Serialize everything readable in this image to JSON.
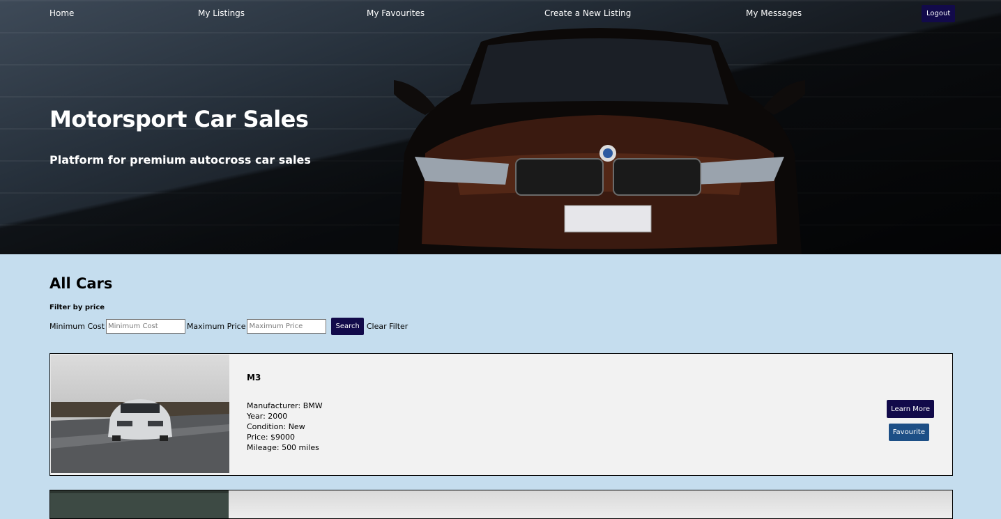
{
  "nav": {
    "home": "Home",
    "my_listings": "My Listings",
    "my_favourites": "My Favourites",
    "create_listing": "Create a New Listing",
    "my_messages": "My Messages",
    "logout": "Logout"
  },
  "hero": {
    "title": "Motorsport Car Sales",
    "subtitle": "Platform for premium autocross car sales",
    "image": "car-front-photo"
  },
  "main": {
    "section_title": "All Cars",
    "filter": {
      "label": "Filter by price",
      "min_label": "Minimum Cost",
      "min_placeholder": "Minimum Cost",
      "min_value": "",
      "max_label": "Maximum Price",
      "max_placeholder": "Maximum Price",
      "max_value": "",
      "search_label": "Search",
      "clear_label": "Clear Filter"
    },
    "listings": [
      {
        "model": "M3",
        "image": "silver-car-on-track-photo",
        "manufacturer": "Manufacturer: BMW",
        "year": "Year: 2000",
        "condition": "Condition: New",
        "price": "Price: $9000",
        "mileage": "Mileage: 500 miles",
        "learn_more_label": "Learn More",
        "favourite_label": "Favourite"
      }
    ]
  },
  "colors": {
    "page_bg": "#c5ddee",
    "primary_button": "#120a4a",
    "favourite_button": "#1d4f86",
    "card_bg": "#f2f2f2"
  }
}
